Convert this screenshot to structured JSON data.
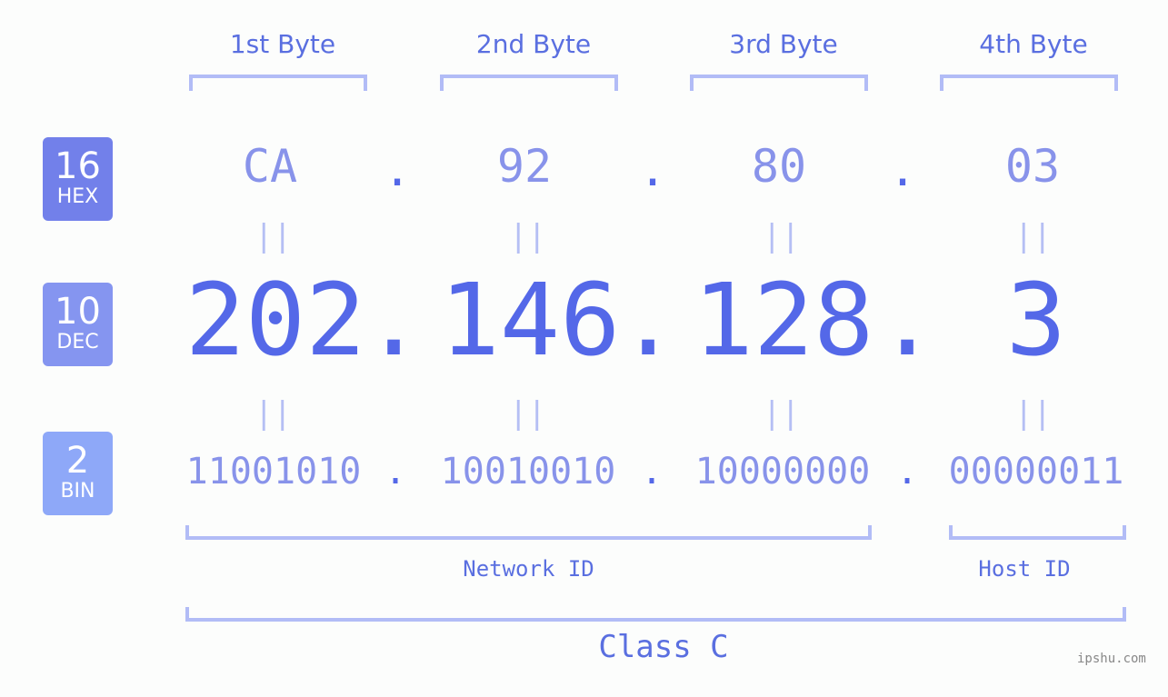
{
  "headers": [
    "1st Byte",
    "2nd Byte",
    "3rd Byte",
    "4th Byte"
  ],
  "badges": [
    {
      "num": "16",
      "label": "HEX",
      "color": "#7280ea"
    },
    {
      "num": "10",
      "label": "DEC",
      "color": "#8595f0"
    },
    {
      "num": "2",
      "label": "BIN",
      "color": "#8ea8f8"
    }
  ],
  "hex": [
    "CA",
    "92",
    "80",
    "03"
  ],
  "dec": [
    "202",
    "146",
    "128",
    "3"
  ],
  "bin": [
    "11001010",
    "10010010",
    "10000000",
    "00000011"
  ],
  "separator": ".",
  "equals": "||",
  "network_label": "Network ID",
  "host_label": "Host ID",
  "class_label": "Class C",
  "watermark": "ipshu.com"
}
